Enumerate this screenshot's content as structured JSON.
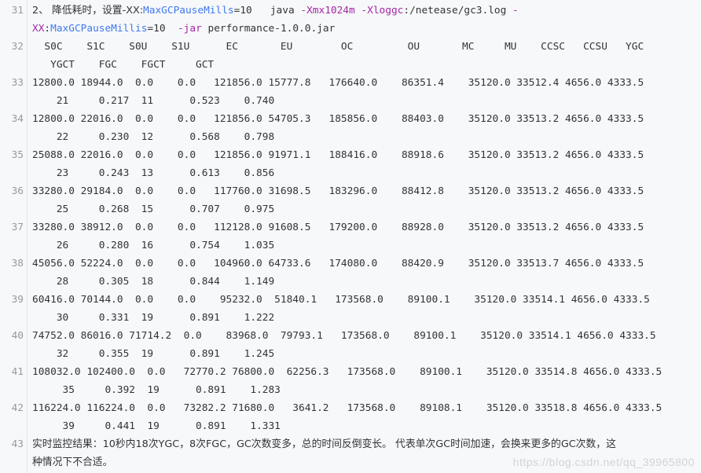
{
  "code_block": {
    "lines": [
      {
        "num": "31",
        "wrap": true,
        "segments": [
          {
            "t": "2、 降低耗时，设置-XX:",
            "c": "text",
            "cjk": true
          },
          {
            "t": "MaxGCPauseMills",
            "c": "attr"
          },
          {
            "t": "=10   java ",
            "c": "text"
          },
          {
            "t": "-Xmx1024m -Xloggc",
            "c": "kw"
          },
          {
            "t": ":/netease/gc3.log ",
            "c": "text"
          },
          {
            "t": "-",
            "c": "kw"
          }
        ],
        "segments2": [
          {
            "t": "XX",
            "c": "kw"
          },
          {
            "t": ":",
            "c": "text"
          },
          {
            "t": "MaxGCPauseMillis",
            "c": "attr"
          },
          {
            "t": "=10  ",
            "c": "text"
          },
          {
            "t": "-jar",
            "c": "kw"
          },
          {
            "t": " performance-1.0.0.jar",
            "c": "text"
          }
        ]
      },
      {
        "num": "32",
        "text": "  S0C    S1C    S0U    S1U      EC       EU        OC         OU       MC     MU    CCSC   CCSU   YGC",
        "text2": "   YGCT    FGC    FGCT     GCT"
      },
      {
        "num": "33",
        "text": "12800.0 18944.0  0.0    0.0   121856.0 15777.8   176640.0    86351.4    35120.0 33512.4 4656.0 4333.5",
        "text2": "    21     0.217  11      0.523    0.740"
      },
      {
        "num": "34",
        "text": "12800.0 22016.0  0.0    0.0   121856.0 54705.3   185856.0    88403.0    35120.0 33513.2 4656.0 4333.5",
        "text2": "    22     0.230  12      0.568    0.798"
      },
      {
        "num": "35",
        "text": "25088.0 22016.0  0.0    0.0   121856.0 91971.1   188416.0    88918.6    35120.0 33513.2 4656.0 4333.5",
        "text2": "    23     0.243  13      0.613    0.856"
      },
      {
        "num": "36",
        "text": "33280.0 29184.0  0.0    0.0   117760.0 31698.5   183296.0    88412.8    35120.0 33513.2 4656.0 4333.5",
        "text2": "    25     0.268  15      0.707    0.975"
      },
      {
        "num": "37",
        "text": "33280.0 38912.0  0.0    0.0   112128.0 91608.5   179200.0    88928.0    35120.0 33513.2 4656.0 4333.5",
        "text2": "    26     0.280  16      0.754    1.035"
      },
      {
        "num": "38",
        "text": "45056.0 52224.0  0.0    0.0   104960.0 64733.6   174080.0    88420.9    35120.0 33513.7 4656.0 4333.5",
        "text2": "    28     0.305  18      0.844    1.149"
      },
      {
        "num": "39",
        "text": "60416.0 70144.0  0.0    0.0    95232.0  51840.1   173568.0    89100.1    35120.0 33514.1 4656.0 4333.5",
        "text2": "    30     0.331  19      0.891    1.222"
      },
      {
        "num": "40",
        "text": "74752.0 86016.0 71714.2  0.0    83968.0  79793.1   173568.0    89100.1    35120.0 33514.1 4656.0 4333.5",
        "text2": "    32     0.355  19      0.891    1.245"
      },
      {
        "num": "41",
        "text": "108032.0 102400.0  0.0   72770.2 76800.0  62256.3   173568.0    89100.1    35120.0 33514.8 4656.0 4333.5",
        "text2": "     35     0.392  19      0.891    1.283"
      },
      {
        "num": "42",
        "text": "116224.0 116224.0  0.0   73282.2 71680.0   3641.2   173568.0    89108.1    35120.0 33518.8 4656.0 4333.5",
        "text2": "     39     0.441  19      0.891    1.331"
      },
      {
        "num": "43",
        "text": "实时监控结果：10秒内18次YGC，8次FGC，GC次数变多，总的时间反倒变长。 代表单次GC时间加速，会换来更多的GC次数，这",
        "text2": "种情况下不合适。",
        "cjk": true
      }
    ]
  },
  "watermark": "https://blog.csdn.net/qq_39965800",
  "colors": {
    "background": "#f6f8fa",
    "text": "#333333",
    "line_number": "#999999",
    "keyword": "#a626a4",
    "attribute": "#4078f2"
  }
}
